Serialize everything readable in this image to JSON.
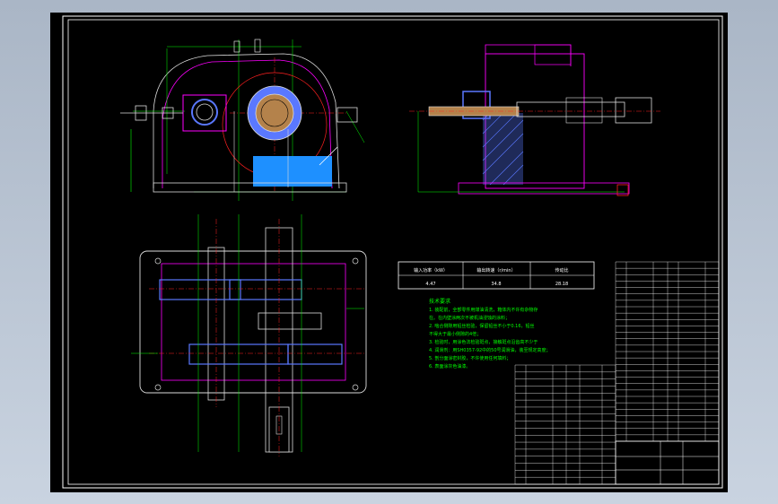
{
  "drawing": {
    "param_table": {
      "headers": [
        "输入功率（kW）",
        "输出转速（r/min）",
        "传动比"
      ],
      "values": [
        "4.47",
        "34.8",
        "28.18"
      ]
    },
    "tech_requirements": {
      "title": "技术要求",
      "lines": [
        "1. 装配前，全部零件用煤油清洗，箱体内不许有杂物存",
        "在。在内壁涂两次不被机油浸蚀的涂料；",
        "2. 啮合侧隙用铅丝检验，保留铅丝不小于0.16，铅丝",
        "不得大于最小侧隙的4倍；",
        "3. 检验时，用涂色法检验斑点，接触斑点沿齿高不少于",
        "4. 润滑剂：用SH0357-92中的50号润滑油，装至规定高度；",
        "5. 剖分面涂密封胶，不许使用任何填料；",
        "6. 表面涂灰色油漆。"
      ]
    },
    "colors": {
      "background": "#000000",
      "frame": "#ffffff",
      "outline": "#ff00ff",
      "dimension": "#00ff00",
      "center_line": "#ff0000",
      "oil": "#1e90ff",
      "section": "#5a78ff"
    }
  }
}
